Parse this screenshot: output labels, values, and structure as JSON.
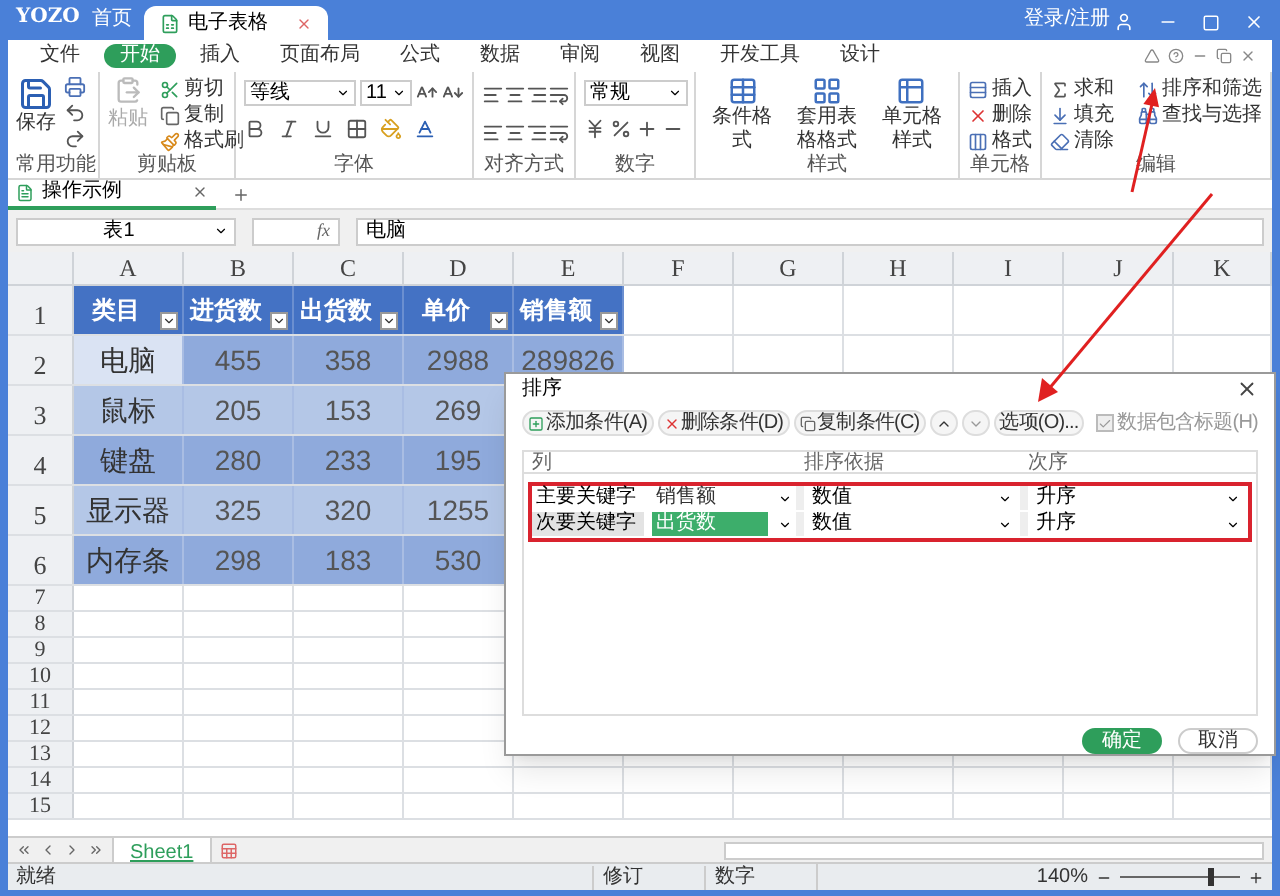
{
  "title_bar": {
    "logo": "YOZO",
    "home_tab": "首页",
    "document_tab": "电子表格",
    "account": "登录/注册"
  },
  "menu": [
    {
      "label": "文件",
      "selected": false
    },
    {
      "label": "开始",
      "selected": true
    },
    {
      "label": "插入",
      "selected": false
    },
    {
      "label": "页面布局",
      "selected": false
    },
    {
      "label": "公式",
      "selected": false
    },
    {
      "label": "数据",
      "selected": false
    },
    {
      "label": "审阅",
      "selected": false
    },
    {
      "label": "视图",
      "selected": false
    },
    {
      "label": "开发工具",
      "selected": false
    },
    {
      "label": "设计",
      "selected": false
    }
  ],
  "ribbon": {
    "common": {
      "label": "常用功能",
      "save": "保存"
    },
    "clipboard": {
      "label": "剪贴板",
      "paste": {
        "label": "粘贴",
        "disabled": true
      },
      "cut": "剪切",
      "copy": "复制",
      "format_painter": "格式刷"
    },
    "font": {
      "label": "字体",
      "family": "等线",
      "size": "11"
    },
    "alignment": {
      "label": "对齐方式"
    },
    "number": {
      "label": "数字",
      "format": "常规"
    },
    "styles": {
      "label": "样式",
      "conditional": "条件格式",
      "table_format": "套用表格格式",
      "cell_style": "单元格样式"
    },
    "cells": {
      "label": "单元格",
      "insert": "插入",
      "delete": "删除",
      "format": "格式"
    },
    "editing": {
      "label": "编辑",
      "sum": "求和",
      "fill": "填充",
      "clear": "清除",
      "sort_filter": "排序和筛选",
      "find": "查找与选择"
    }
  },
  "doc_tabs": [
    {
      "label": "操作示例",
      "selected": true
    }
  ],
  "formula_bar": {
    "name_box": "表1",
    "function_label": "fx",
    "formula": "电脑"
  },
  "sheet": {
    "columns": [
      "A",
      "B",
      "C",
      "D",
      "E",
      "F",
      "G",
      "H",
      "I",
      "J",
      "K"
    ],
    "row_numbers": [
      "1",
      "2",
      "3",
      "4",
      "5",
      "6",
      "7",
      "8",
      "9",
      "10",
      "11",
      "12",
      "13",
      "14",
      "15"
    ],
    "header": [
      "类目",
      "进货数",
      "出货数",
      "单价",
      "销售额"
    ],
    "rows": [
      {
        "cells": [
          {
            "text": "电脑",
            "selected": true
          },
          {
            "text": "455",
            "selected": false
          },
          {
            "text": "358",
            "selected": false
          },
          {
            "text": "2988",
            "selected": false
          },
          {
            "text": "289826",
            "selected": false
          }
        ]
      },
      {
        "cells": [
          {
            "text": "鼠标",
            "selected": false
          },
          {
            "text": "205",
            "selected": false
          },
          {
            "text": "153",
            "selected": false
          },
          {
            "text": "269",
            "selected": false
          }
        ]
      },
      {
        "cells": [
          {
            "text": "键盘",
            "selected": false
          },
          {
            "text": "280",
            "selected": false
          },
          {
            "text": "233",
            "selected": false
          },
          {
            "text": "195",
            "selected": false
          }
        ]
      },
      {
        "cells": [
          {
            "text": "显示器",
            "selected": false
          },
          {
            "text": "325",
            "selected": false
          },
          {
            "text": "320",
            "selected": false
          },
          {
            "text": "1255",
            "selected": false
          }
        ]
      },
      {
        "cells": [
          {
            "text": "内存条",
            "selected": false
          },
          {
            "text": "298",
            "selected": false
          },
          {
            "text": "183",
            "selected": false
          },
          {
            "text": "530",
            "selected": false
          }
        ]
      }
    ]
  },
  "sheet_tabs": [
    {
      "label": "Sheet1",
      "selected": true
    }
  ],
  "status_bar": {
    "status": "就绪",
    "indicators": [
      "修订",
      "数字"
    ],
    "zoom": "140%",
    "zoom_slider": {
      "level": 0.75
    }
  },
  "dialog": {
    "title": "排序",
    "toolbar": [
      {
        "kind": "add",
        "label": "添加条件(A)"
      },
      {
        "kind": "delete",
        "label": "删除条件(D)"
      },
      {
        "kind": "copy",
        "label": "复制条件(C)"
      },
      {
        "kind": "up"
      },
      {
        "kind": "down"
      },
      {
        "kind": "options",
        "label": "选项(O)..."
      }
    ],
    "header_checkbox": {
      "label": "数据包含标题(H)",
      "checked": true,
      "disabled": true
    },
    "columns": [
      "列",
      "排序依据",
      "次序"
    ],
    "rows": [
      {
        "label": "主要关键字",
        "column": "销售额",
        "basis": "数值",
        "order": "升序",
        "selected": false
      },
      {
        "label": "次要关键字",
        "column": "出货数",
        "basis": "数值",
        "order": "升序",
        "selected": true
      }
    ],
    "buttons": [
      {
        "kind": "primary",
        "label": "确定"
      },
      {
        "kind": "secondary",
        "label": "取消"
      }
    ]
  }
}
